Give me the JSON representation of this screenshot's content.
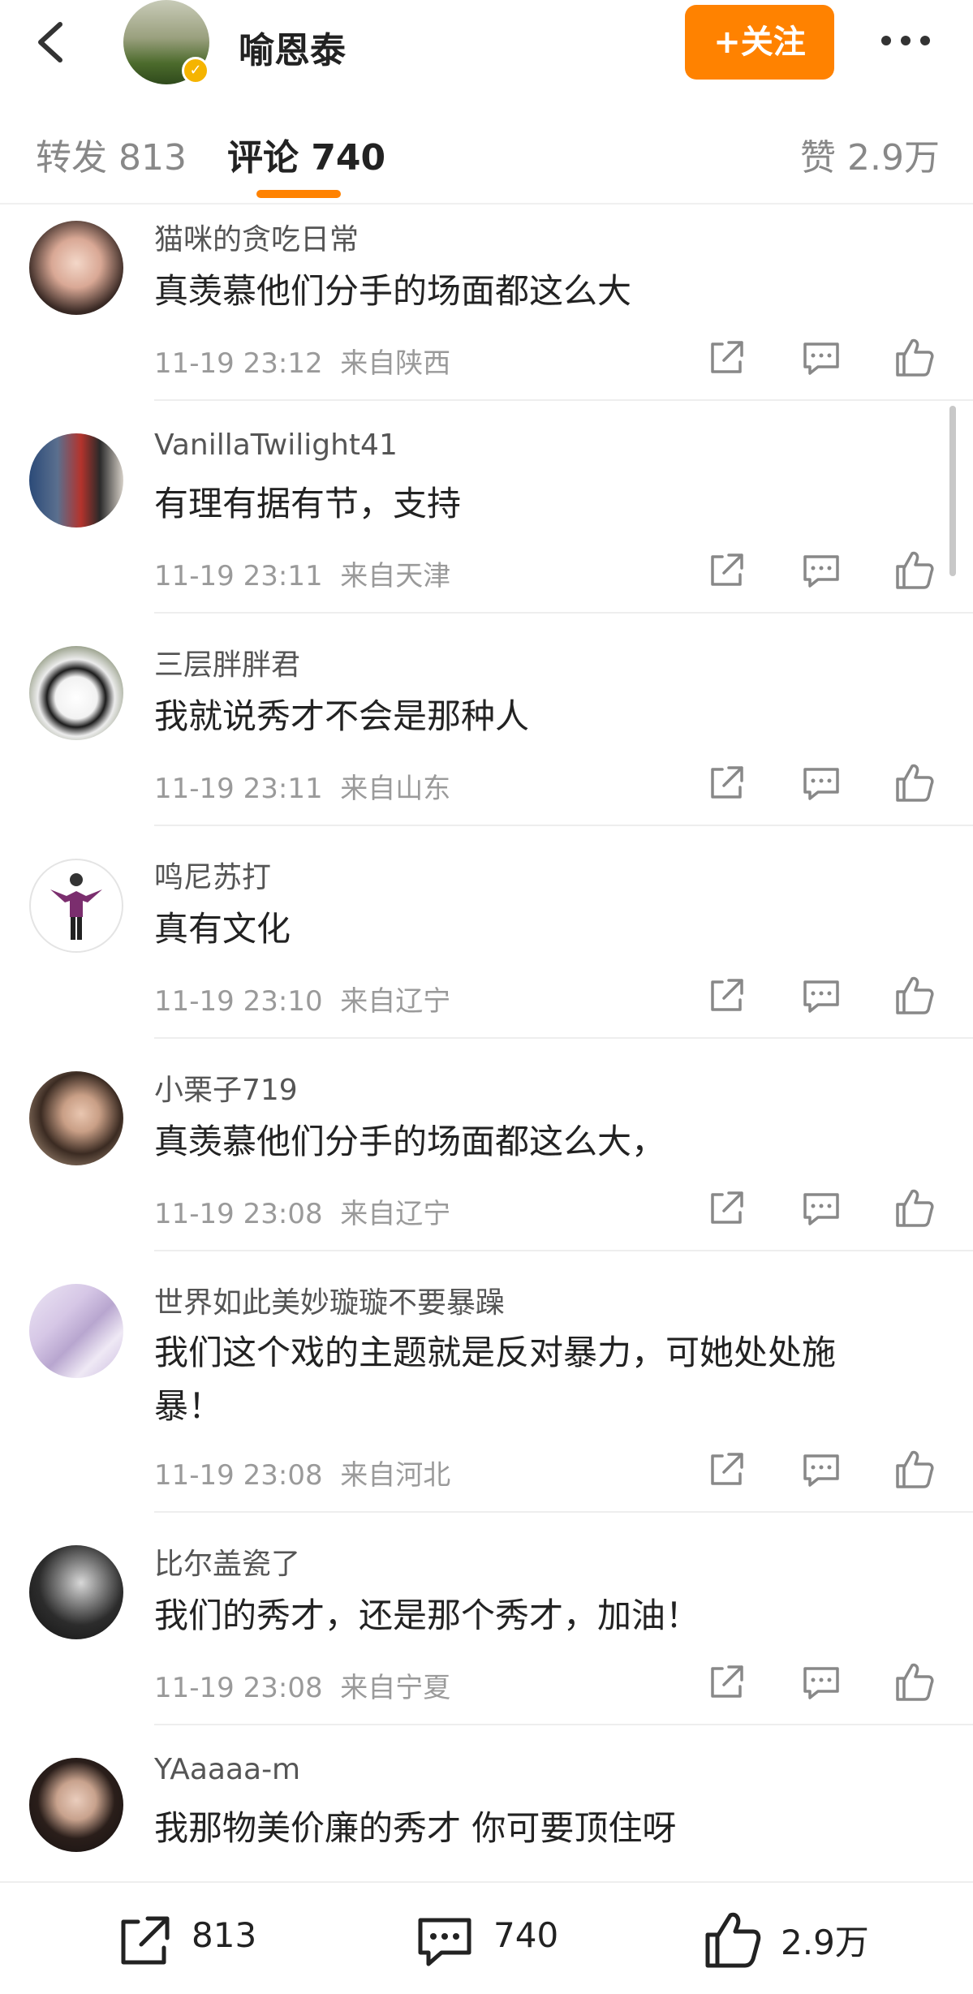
{
  "header": {
    "author_name": "喻恩泰",
    "follow_label": "+关注"
  },
  "tabs": {
    "repost": "转发 813",
    "comment": "评论 740",
    "like": "赞 2.9万"
  },
  "comments": [
    {
      "user": "猫咪的贪吃日常",
      "text": "真羡慕他们分手的场面都这么大",
      "time": "11-19 23:12",
      "location": "来自陕西"
    },
    {
      "user": "VanillaTwilight41",
      "text": "有理有据有节，支持",
      "time": "11-19 23:11",
      "location": "来自天津"
    },
    {
      "user": "三层胖胖君",
      "text": "我就说秀才不会是那种人",
      "time": "11-19 23:11",
      "location": "来自山东"
    },
    {
      "user": "鸣尼苏打",
      "text": "真有文化",
      "time": "11-19 23:10",
      "location": "来自辽宁"
    },
    {
      "user": "小栗子719",
      "text": "真羡慕他们分手的场面都这么大，",
      "time": "11-19 23:08",
      "location": "来自辽宁"
    },
    {
      "user": "世界如此美妙璇璇不要暴躁",
      "text": "我们这个戏的主题就是反对暴力，可她处处施暴！",
      "time": "11-19 23:08",
      "location": "来自河北"
    },
    {
      "user": "比尔盖瓷了",
      "text": "我们的秀才，还是那个秀才，加油！",
      "time": "11-19 23:08",
      "location": "来自宁夏"
    },
    {
      "user": "YAaaaa-m",
      "text": "我那物美价廉的秀才 你可要顶住呀",
      "time": "",
      "location": ""
    }
  ],
  "bottom_bar": {
    "repost_count": "813",
    "comment_count": "740",
    "like_count": "2.9万"
  },
  "colors": {
    "accent": "#ff8200",
    "verify_badge": "#f5b400",
    "meta_text": "#9a9a9a"
  },
  "icons": [
    "back-arrow-icon",
    "more-dots-icon",
    "verified-icon",
    "share-icon",
    "comment-bubble-icon",
    "like-thumb-icon"
  ]
}
